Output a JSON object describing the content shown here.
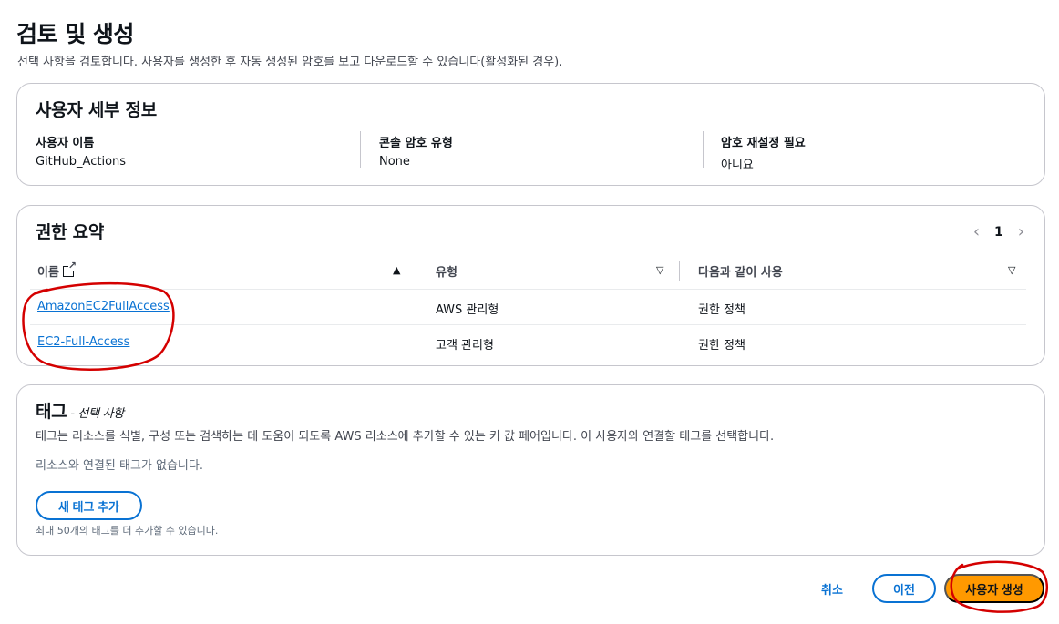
{
  "page": {
    "title": "검토 및 생성",
    "description": "선택 사항을 검토합니다. 사용자를 생성한 후 자동 생성된 암호를 보고 다운로드할 수 있습니다(활성화된 경우)."
  },
  "user_details": {
    "title": "사용자 세부 정보",
    "fields": [
      {
        "label": "사용자 이름",
        "value": "GitHub_Actions"
      },
      {
        "label": "콘솔 암호 유형",
        "value": "None"
      },
      {
        "label": "암호 재설정 필요",
        "value": "아니요"
      }
    ]
  },
  "permissions": {
    "title": "권한 요약",
    "page_number": "1",
    "columns": [
      "이름",
      "유형",
      "다음과 같이 사용"
    ],
    "rows": [
      {
        "name": "AmazonEC2FullAccess",
        "type": "AWS 관리형",
        "used_as": "권한 정책"
      },
      {
        "name": "EC2-Full-Access",
        "type": "고객 관리형",
        "used_as": "권한 정책"
      }
    ]
  },
  "tags": {
    "title": "태그",
    "subtitle": " - 선택 사항",
    "description": "태그는 리소스를 식별, 구성 또는 검색하는 데 도움이 되도록 AWS 리소스에 추가할 수 있는 키 값 페어입니다. 이 사용자와 연결할 태그를 선택합니다.",
    "empty_text": "리소스와 연결된 태그가 없습니다.",
    "add_button": "새 태그 추가",
    "limit_text": "최대 50개의 태그를 더 추가할 수 있습니다."
  },
  "footer": {
    "cancel": "취소",
    "previous": "이전",
    "create": "사용자 생성"
  },
  "colors": {
    "link": "#0972d3",
    "primary_button": "#ff9900",
    "annotation": "#d40000"
  }
}
